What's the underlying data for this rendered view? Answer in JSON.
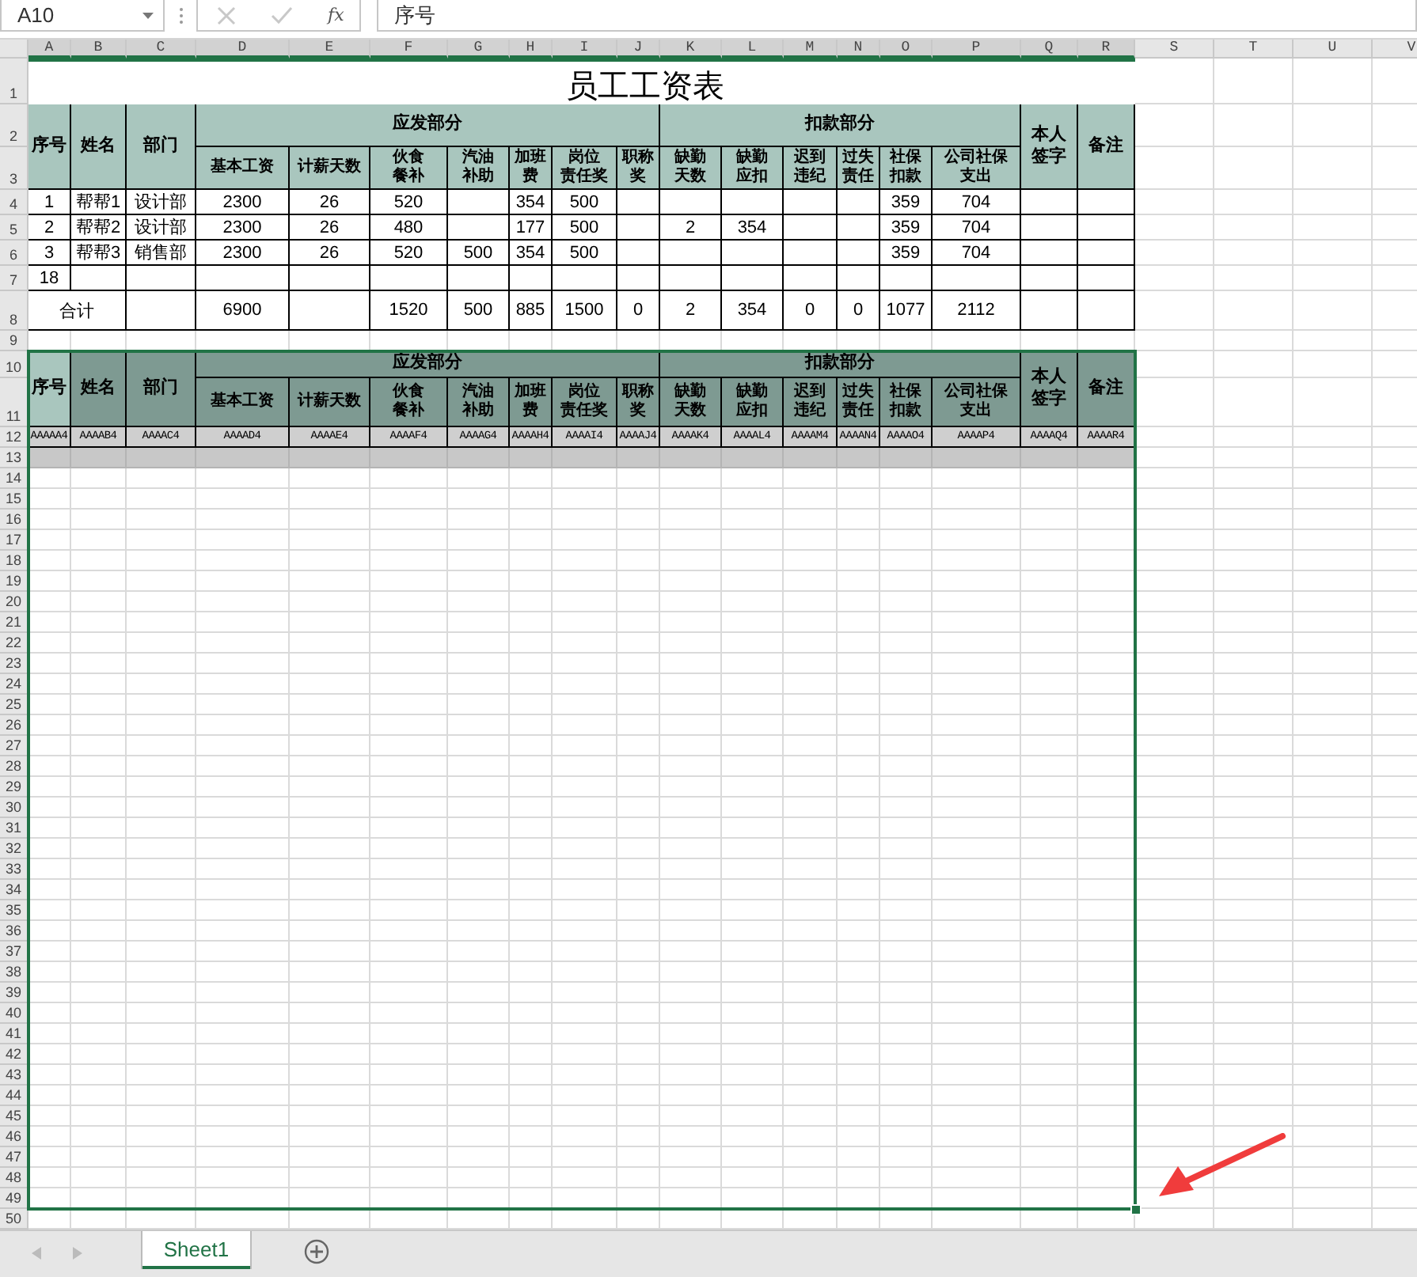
{
  "formula_bar": {
    "name_box": "A10",
    "insert_function_label": "fx",
    "formula": "序号"
  },
  "column_headers": [
    "A",
    "B",
    "C",
    "D",
    "E",
    "F",
    "G",
    "H",
    "I",
    "J",
    "K",
    "L",
    "M",
    "N",
    "O",
    "P",
    "Q",
    "R",
    "S",
    "T",
    "U",
    "V"
  ],
  "row_headers": [
    "1",
    "2",
    "3",
    "4",
    "5",
    "6",
    "7",
    "8",
    "9",
    "10",
    "11",
    "12",
    "13",
    "14",
    "15",
    "16",
    "17",
    "18",
    "19",
    "20",
    "21",
    "22",
    "23",
    "24",
    "25",
    "26",
    "27",
    "28",
    "29",
    "30",
    "31",
    "32",
    "33",
    "34",
    "35",
    "36",
    "37",
    "38",
    "39",
    "40",
    "41",
    "42",
    "43",
    "44",
    "45",
    "46",
    "47",
    "48",
    "49",
    "50"
  ],
  "title": "员工工资表",
  "header": {
    "left": [
      {
        "label": "序号"
      },
      {
        "label": "姓名"
      },
      {
        "label": "部门"
      }
    ],
    "groups": [
      {
        "label": "应发部分",
        "columns": [
          "基本工资",
          "计薪天数",
          "伙食餐补",
          "汽油补助",
          "加班费",
          "岗位责任奖",
          "职称奖"
        ]
      },
      {
        "label": "扣款部分",
        "columns": [
          "缺勤天数",
          "缺勤应扣",
          "迟到违纪",
          "过失责任",
          "社保扣款",
          "公司社保支出"
        ]
      }
    ],
    "right": [
      "本人签字",
      "备注"
    ]
  },
  "rows": [
    [
      "1",
      "帮帮1",
      "设计部",
      "2300",
      "26",
      "520",
      null,
      "354",
      "500",
      null,
      null,
      null,
      null,
      null,
      "359",
      "704",
      null,
      null
    ],
    [
      "2",
      "帮帮2",
      "设计部",
      "2300",
      "26",
      "480",
      null,
      "177",
      "500",
      null,
      "2",
      "354",
      null,
      null,
      "359",
      "704",
      null,
      null
    ],
    [
      "3",
      "帮帮3",
      "销售部",
      "2300",
      "26",
      "520",
      "500",
      "354",
      "500",
      null,
      null,
      null,
      null,
      null,
      "359",
      "704",
      null,
      null
    ],
    [
      "18",
      null,
      null,
      null,
      null,
      null,
      null,
      null,
      null,
      null,
      null,
      null,
      null,
      null,
      null,
      null,
      null,
      null
    ]
  ],
  "total": {
    "label": "合计",
    "cells": [
      null,
      "6900",
      null,
      "1520",
      "500",
      "885",
      "1500",
      "0",
      "2",
      "354",
      "0",
      "0",
      "1077",
      "2112",
      null,
      null
    ]
  },
  "template": {
    "header": {
      "left": [
        {
          "label": "序号",
          "selected": true
        },
        {
          "label": "姓名",
          "selected": false
        },
        {
          "label": "部门",
          "selected": false
        }
      ],
      "groups": [
        {
          "label": "应发部分",
          "columns": [
            "基本工资",
            "计薪天数",
            "伙食餐补",
            "汽油补助",
            "加班费",
            "岗位责任奖",
            "职称奖"
          ]
        },
        {
          "label": "扣款部分",
          "columns": [
            "缺勤天数",
            "缺勤应扣",
            "迟到违纪",
            "过失责任",
            "社保扣款",
            "公司社保支出"
          ]
        }
      ],
      "right": [
        "本人签字",
        "备注"
      ]
    },
    "placeholders": [
      "AAAAA4",
      "AAAAB4",
      "AAAAC4",
      "AAAAD4",
      "AAAAE4",
      "AAAAF4",
      "AAAAG4",
      "AAAAH4",
      "AAAAI4",
      "AAAAJ4",
      "AAAAK4",
      "AAAAL4",
      "AAAAM4",
      "AAAAN4",
      "AAAAO4",
      "AAAAP4",
      "AAAAQ4",
      "AAAAR4"
    ]
  },
  "sheet_tabs": [
    {
      "label": "Sheet1",
      "selected": true
    }
  ]
}
